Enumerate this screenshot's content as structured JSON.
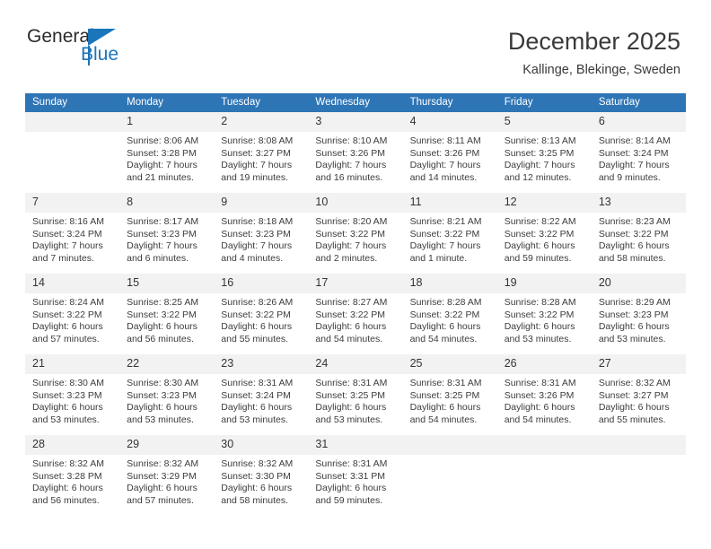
{
  "brand": {
    "name_top": "General",
    "name_bottom": "Blue",
    "accent_color": "#1b75bb"
  },
  "header": {
    "title": "December 2025",
    "subtitle": "Kallinge, Blekinge, Sweden"
  },
  "theme": {
    "header_blue": "#2e75b6",
    "daynum_bg": "#f2f2f2",
    "text": "#3c3c3c"
  },
  "labels": {
    "sunrise_prefix": "Sunrise:",
    "sunset_prefix": "Sunset:",
    "daylight_prefix": "Daylight:"
  },
  "weekday_headers": [
    "Sunday",
    "Monday",
    "Tuesday",
    "Wednesday",
    "Thursday",
    "Friday",
    "Saturday"
  ],
  "weeks": [
    [
      {
        "day": "",
        "lines": []
      },
      {
        "day": "1",
        "lines": [
          "Sunrise: 8:06 AM",
          "Sunset: 3:28 PM",
          "Daylight: 7 hours",
          "and 21 minutes."
        ]
      },
      {
        "day": "2",
        "lines": [
          "Sunrise: 8:08 AM",
          "Sunset: 3:27 PM",
          "Daylight: 7 hours",
          "and 19 minutes."
        ]
      },
      {
        "day": "3",
        "lines": [
          "Sunrise: 8:10 AM",
          "Sunset: 3:26 PM",
          "Daylight: 7 hours",
          "and 16 minutes."
        ]
      },
      {
        "day": "4",
        "lines": [
          "Sunrise: 8:11 AM",
          "Sunset: 3:26 PM",
          "Daylight: 7 hours",
          "and 14 minutes."
        ]
      },
      {
        "day": "5",
        "lines": [
          "Sunrise: 8:13 AM",
          "Sunset: 3:25 PM",
          "Daylight: 7 hours",
          "and 12 minutes."
        ]
      },
      {
        "day": "6",
        "lines": [
          "Sunrise: 8:14 AM",
          "Sunset: 3:24 PM",
          "Daylight: 7 hours",
          "and 9 minutes."
        ]
      }
    ],
    [
      {
        "day": "7",
        "lines": [
          "Sunrise: 8:16 AM",
          "Sunset: 3:24 PM",
          "Daylight: 7 hours",
          "and 7 minutes."
        ]
      },
      {
        "day": "8",
        "lines": [
          "Sunrise: 8:17 AM",
          "Sunset: 3:23 PM",
          "Daylight: 7 hours",
          "and 6 minutes."
        ]
      },
      {
        "day": "9",
        "lines": [
          "Sunrise: 8:18 AM",
          "Sunset: 3:23 PM",
          "Daylight: 7 hours",
          "and 4 minutes."
        ]
      },
      {
        "day": "10",
        "lines": [
          "Sunrise: 8:20 AM",
          "Sunset: 3:22 PM",
          "Daylight: 7 hours",
          "and 2 minutes."
        ]
      },
      {
        "day": "11",
        "lines": [
          "Sunrise: 8:21 AM",
          "Sunset: 3:22 PM",
          "Daylight: 7 hours",
          "and 1 minute."
        ]
      },
      {
        "day": "12",
        "lines": [
          "Sunrise: 8:22 AM",
          "Sunset: 3:22 PM",
          "Daylight: 6 hours",
          "and 59 minutes."
        ]
      },
      {
        "day": "13",
        "lines": [
          "Sunrise: 8:23 AM",
          "Sunset: 3:22 PM",
          "Daylight: 6 hours",
          "and 58 minutes."
        ]
      }
    ],
    [
      {
        "day": "14",
        "lines": [
          "Sunrise: 8:24 AM",
          "Sunset: 3:22 PM",
          "Daylight: 6 hours",
          "and 57 minutes."
        ]
      },
      {
        "day": "15",
        "lines": [
          "Sunrise: 8:25 AM",
          "Sunset: 3:22 PM",
          "Daylight: 6 hours",
          "and 56 minutes."
        ]
      },
      {
        "day": "16",
        "lines": [
          "Sunrise: 8:26 AM",
          "Sunset: 3:22 PM",
          "Daylight: 6 hours",
          "and 55 minutes."
        ]
      },
      {
        "day": "17",
        "lines": [
          "Sunrise: 8:27 AM",
          "Sunset: 3:22 PM",
          "Daylight: 6 hours",
          "and 54 minutes."
        ]
      },
      {
        "day": "18",
        "lines": [
          "Sunrise: 8:28 AM",
          "Sunset: 3:22 PM",
          "Daylight: 6 hours",
          "and 54 minutes."
        ]
      },
      {
        "day": "19",
        "lines": [
          "Sunrise: 8:28 AM",
          "Sunset: 3:22 PM",
          "Daylight: 6 hours",
          "and 53 minutes."
        ]
      },
      {
        "day": "20",
        "lines": [
          "Sunrise: 8:29 AM",
          "Sunset: 3:23 PM",
          "Daylight: 6 hours",
          "and 53 minutes."
        ]
      }
    ],
    [
      {
        "day": "21",
        "lines": [
          "Sunrise: 8:30 AM",
          "Sunset: 3:23 PM",
          "Daylight: 6 hours",
          "and 53 minutes."
        ]
      },
      {
        "day": "22",
        "lines": [
          "Sunrise: 8:30 AM",
          "Sunset: 3:23 PM",
          "Daylight: 6 hours",
          "and 53 minutes."
        ]
      },
      {
        "day": "23",
        "lines": [
          "Sunrise: 8:31 AM",
          "Sunset: 3:24 PM",
          "Daylight: 6 hours",
          "and 53 minutes."
        ]
      },
      {
        "day": "24",
        "lines": [
          "Sunrise: 8:31 AM",
          "Sunset: 3:25 PM",
          "Daylight: 6 hours",
          "and 53 minutes."
        ]
      },
      {
        "day": "25",
        "lines": [
          "Sunrise: 8:31 AM",
          "Sunset: 3:25 PM",
          "Daylight: 6 hours",
          "and 54 minutes."
        ]
      },
      {
        "day": "26",
        "lines": [
          "Sunrise: 8:31 AM",
          "Sunset: 3:26 PM",
          "Daylight: 6 hours",
          "and 54 minutes."
        ]
      },
      {
        "day": "27",
        "lines": [
          "Sunrise: 8:32 AM",
          "Sunset: 3:27 PM",
          "Daylight: 6 hours",
          "and 55 minutes."
        ]
      }
    ],
    [
      {
        "day": "28",
        "lines": [
          "Sunrise: 8:32 AM",
          "Sunset: 3:28 PM",
          "Daylight: 6 hours",
          "and 56 minutes."
        ]
      },
      {
        "day": "29",
        "lines": [
          "Sunrise: 8:32 AM",
          "Sunset: 3:29 PM",
          "Daylight: 6 hours",
          "and 57 minutes."
        ]
      },
      {
        "day": "30",
        "lines": [
          "Sunrise: 8:32 AM",
          "Sunset: 3:30 PM",
          "Daylight: 6 hours",
          "and 58 minutes."
        ]
      },
      {
        "day": "31",
        "lines": [
          "Sunrise: 8:31 AM",
          "Sunset: 3:31 PM",
          "Daylight: 6 hours",
          "and 59 minutes."
        ]
      },
      {
        "day": "",
        "lines": []
      },
      {
        "day": "",
        "lines": []
      },
      {
        "day": "",
        "lines": []
      }
    ]
  ]
}
